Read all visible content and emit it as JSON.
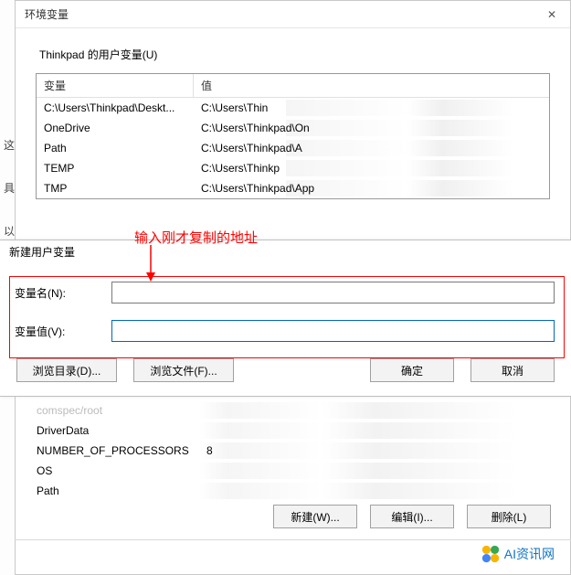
{
  "parentDialog": {
    "title": "环境变量",
    "closeGlyph": "✕",
    "userSectionLabel": "Thinkpad 的用户变量(U)",
    "headers": {
      "name": "变量",
      "value": "值"
    },
    "userVars": [
      {
        "name": "C:\\Users\\Thinkpad\\Deskt...",
        "value": "C:\\Users\\Thin"
      },
      {
        "name": "OneDrive",
        "value": "C:\\Users\\Thinkpad\\On"
      },
      {
        "name": "Path",
        "value": "C:\\Users\\Thinkpad\\A"
      },
      {
        "name": "TEMP",
        "value": "C:\\Users\\Thinkp"
      },
      {
        "name": "TMP",
        "value": "C:\\Users\\Thinkpad\\App"
      }
    ],
    "systemVars": [
      {
        "name": "comspec/root",
        "value": ""
      },
      {
        "name": "DriverData",
        "value": ""
      },
      {
        "name": "NUMBER_OF_PROCESSORS",
        "value": "8"
      },
      {
        "name": "OS",
        "value": ""
      },
      {
        "name": "Path",
        "value": ""
      }
    ],
    "buttons": {
      "new": "新建(W)...",
      "edit": "编辑(I)...",
      "delete": "删除(L)"
    }
  },
  "childDialog": {
    "title": "新建用户变量",
    "nameLabel": "变量名(N):",
    "valueLabel": "变量值(V):",
    "nameValue": "",
    "valueValue": "",
    "browseDir": "浏览目录(D)...",
    "browseFile": "浏览文件(F)...",
    "ok": "确定",
    "cancel": "取消"
  },
  "annotation": {
    "text": "输入刚才复制的地址"
  },
  "leftFragments": [
    "这",
    "具",
    "以"
  ],
  "watermark": {
    "text": "AI资讯网"
  }
}
